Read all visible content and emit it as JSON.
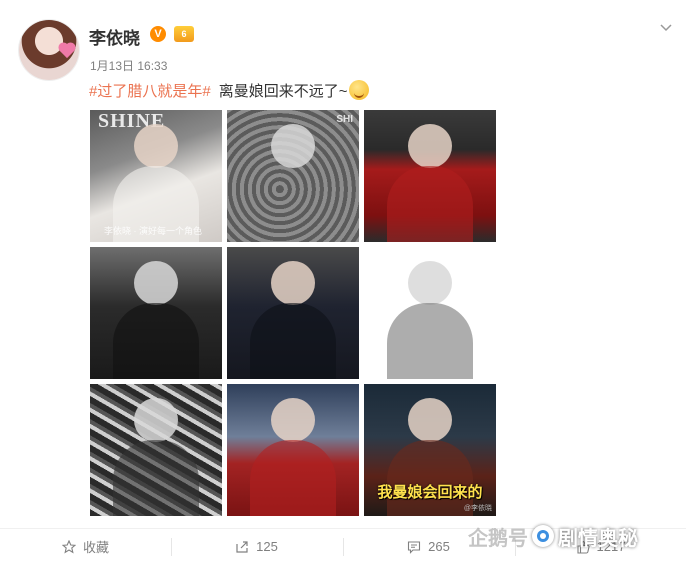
{
  "post": {
    "user": {
      "name": "李依晓",
      "verified_badge": "V",
      "vip_badge": "6"
    },
    "timestamp": "1月13日 16:33",
    "hashtag": "#过了腊八就是年#",
    "text": "离曼娘回来不远了~",
    "emoji_icon": "smirk-emoji-icon",
    "images": [
      {
        "masthead": "SHINE",
        "caption": "李依晓 · 演好每一个角色"
      },
      {
        "masthead": "SHI"
      },
      {},
      {},
      {},
      {},
      {},
      {},
      {
        "caption_big": "我曼娘会回来的",
        "caption_tiny": "@李依晓"
      }
    ]
  },
  "actions": {
    "favorite": {
      "label": "收藏",
      "icon": "star-icon"
    },
    "repost": {
      "count": "125",
      "icon": "share-arrow-icon"
    },
    "comment": {
      "count": "265",
      "icon": "comment-icon"
    },
    "like": {
      "count": "1217",
      "icon": "thumbs-up-icon"
    }
  },
  "watermark": {
    "faint_text": "企鹅号",
    "brand_text": "剧情奥秘"
  },
  "colors": {
    "hashtag": "#eb7350",
    "verified": "#ff8c00",
    "muted": "#808080"
  }
}
